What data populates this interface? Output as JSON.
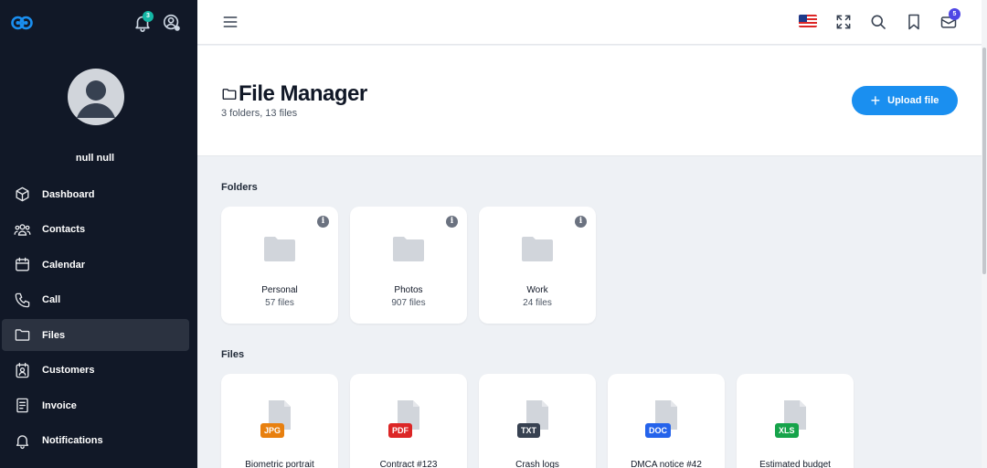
{
  "sidebar": {
    "notification_count": "3",
    "user_name": "null null",
    "items": [
      {
        "label": "Dashboard",
        "icon": "cube-icon"
      },
      {
        "label": "Contacts",
        "icon": "users-icon"
      },
      {
        "label": "Calendar",
        "icon": "calendar-icon"
      },
      {
        "label": "Call",
        "icon": "phone-icon"
      },
      {
        "label": "Files",
        "icon": "folder-icon",
        "active": true
      },
      {
        "label": "Customers",
        "icon": "contact-book-icon"
      },
      {
        "label": "Invoice",
        "icon": "invoice-icon"
      },
      {
        "label": "Notifications",
        "icon": "bell-icon"
      }
    ]
  },
  "topbar": {
    "mail_count": "5"
  },
  "header": {
    "title": "File Manager",
    "subtitle": "3 folders, 13 files",
    "upload_label": "Upload file"
  },
  "folders": {
    "label": "Folders",
    "items": [
      {
        "name": "Personal",
        "count": "57 files"
      },
      {
        "name": "Photos",
        "count": "907 files"
      },
      {
        "name": "Work",
        "count": "24 files"
      }
    ]
  },
  "files": {
    "label": "Files",
    "items": [
      {
        "name": "Biometric portrait",
        "type": "JPG",
        "color": "#e8800f"
      },
      {
        "name": "Contract #123",
        "type": "PDF",
        "color": "#dc2626"
      },
      {
        "name": "Crash logs",
        "type": "TXT",
        "color": "#374151"
      },
      {
        "name": "DMCA notice #42",
        "type": "DOC",
        "color": "#2563eb"
      },
      {
        "name": "Estimated budget",
        "type": "XLS",
        "color": "#16a34a"
      }
    ]
  },
  "colors": {
    "sidebar_bg": "#111827",
    "accent": "#1a8ff0",
    "badge_teal": "#14b8a6",
    "badge_indigo": "#4f46e5"
  }
}
